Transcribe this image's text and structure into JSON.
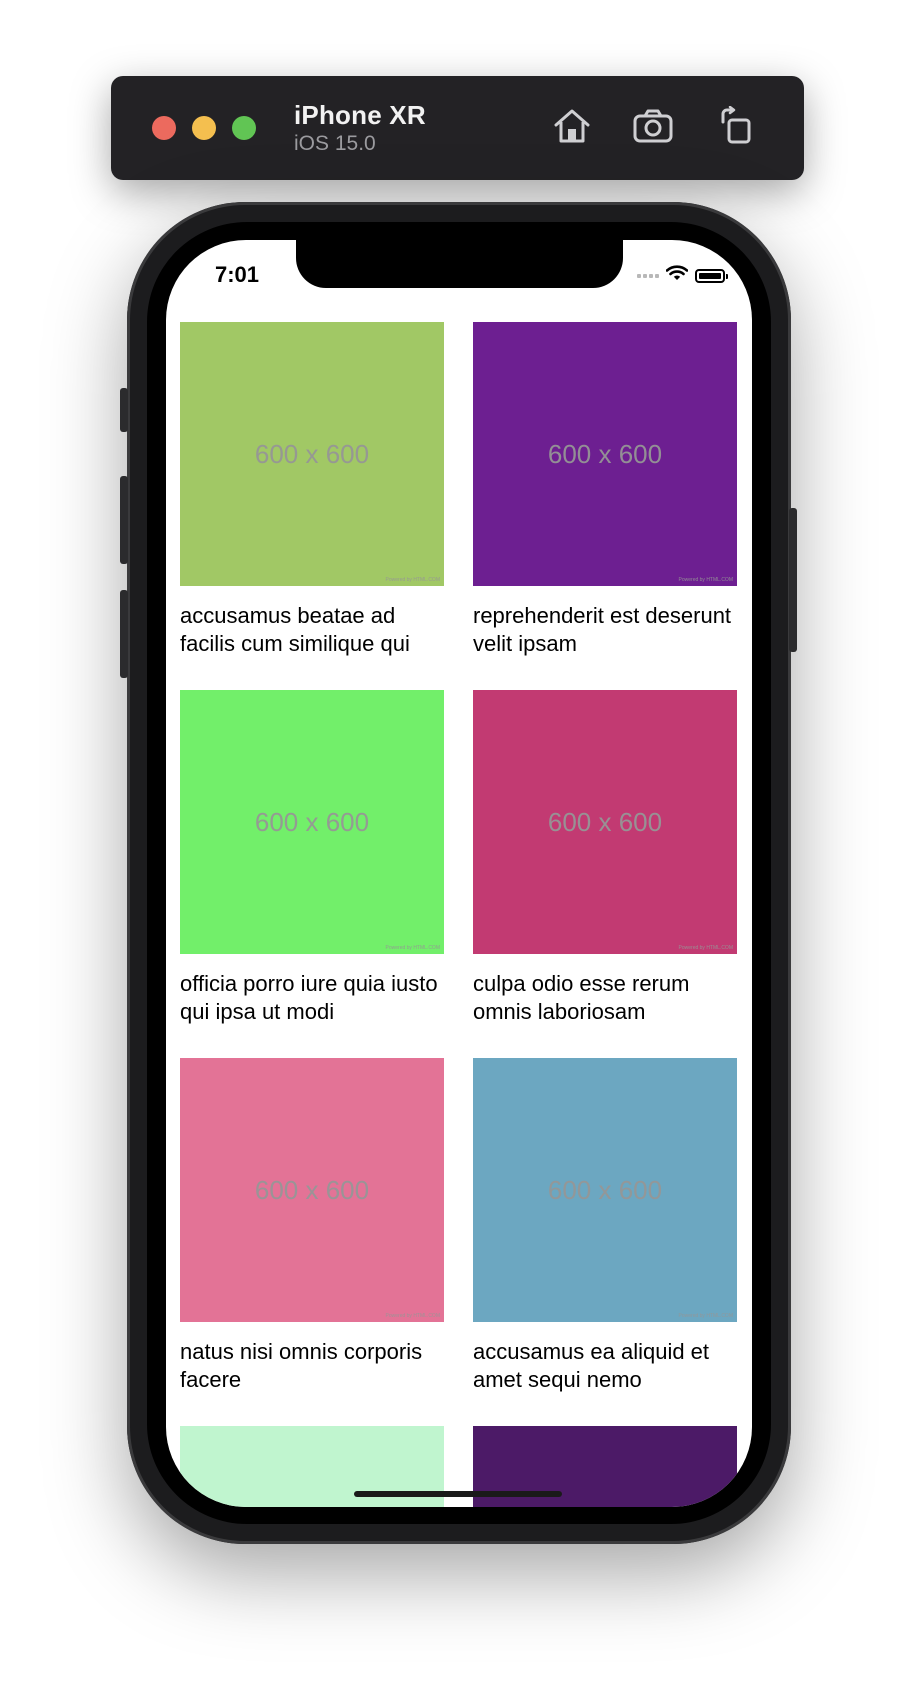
{
  "simulator": {
    "device_name": "iPhone XR",
    "os_version": "iOS 15.0",
    "buttons": [
      "home-icon",
      "camera-icon",
      "rotate-icon"
    ]
  },
  "status_bar": {
    "time": "7:01"
  },
  "grid": {
    "items": [
      {
        "image_text": "600 x 600",
        "credit": "Powered by HTML.COM",
        "color": "#a1c865",
        "caption": "accusamus beatae ad facilis cum similique qui"
      },
      {
        "image_text": "600 x 600",
        "credit": "Powered by HTML.COM",
        "color": "#6d1f91",
        "caption": "reprehenderit est deserunt velit ipsam"
      },
      {
        "image_text": "600 x 600",
        "credit": "Powered by HTML.COM",
        "color": "#72ef6a",
        "caption": "officia porro iure quia iusto qui ipsa ut modi"
      },
      {
        "image_text": "600 x 600",
        "credit": "Powered by HTML.COM",
        "color": "#c23a72",
        "caption": "culpa odio esse rerum omnis laboriosam"
      },
      {
        "image_text": "600 x 600",
        "credit": "Powered by HTML.COM",
        "color": "#e37396",
        "caption": "natus nisi omnis corporis facere"
      },
      {
        "image_text": "600 x 600",
        "credit": "Powered by HTML.COM",
        "color": "#6ca7c1",
        "caption": "accusamus ea aliquid et amet sequi nemo"
      },
      {
        "image_text": "",
        "credit": "",
        "color": "#c0f5cf",
        "caption": ""
      },
      {
        "image_text": "",
        "credit": "",
        "color": "#4c1a67",
        "caption": ""
      }
    ]
  }
}
